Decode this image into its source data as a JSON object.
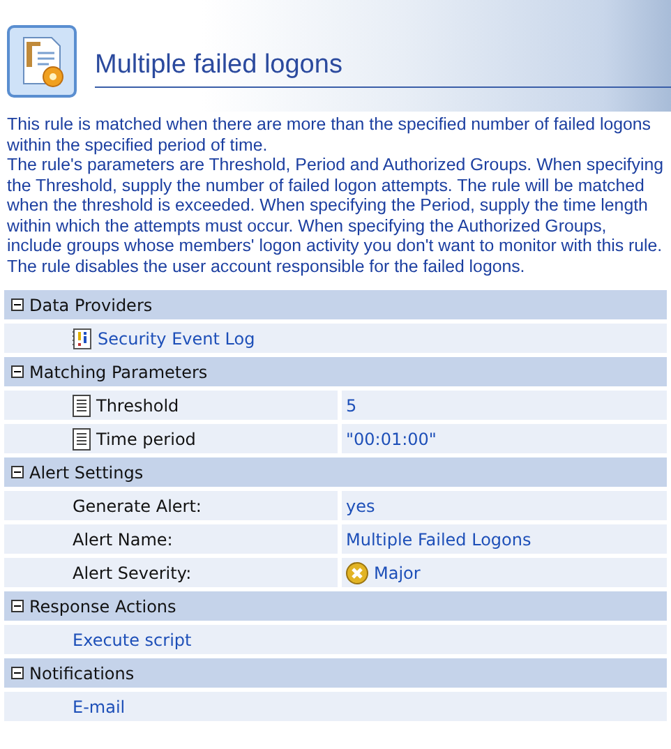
{
  "title": "Multiple failed logons",
  "description": [
    "This rule is matched when there are more than the specified number of failed logons within the specified period of time.",
    "The rule's parameters are Threshold, Period and Authorized Groups. When specifying the Threshold, supply the number of failed logon attempts. The rule will be matched when the threshold is exceeded. When specifying the Period, supply the time length within which the attempts must occur. When specifying the Authorized Groups, include groups whose members' logon activity you don't want to monitor with this rule.",
    "The rule disables the user account responsible for the failed logons."
  ],
  "sections": [
    {
      "title": "Data Providers",
      "expanded": true,
      "rows": [
        {
          "kind": "provider",
          "label": "Security Event Log"
        }
      ]
    },
    {
      "title": "Matching Parameters",
      "expanded": true,
      "rows": [
        {
          "kind": "param",
          "label": "Threshold",
          "value": "5"
        },
        {
          "kind": "param",
          "label": "Time period",
          "value": "\"00:01:00\""
        }
      ]
    },
    {
      "title": "Alert Settings",
      "expanded": true,
      "rows": [
        {
          "kind": "setting",
          "label": "Generate Alert:",
          "value": "yes"
        },
        {
          "kind": "setting",
          "label": "Alert Name:",
          "value": "Multiple Failed Logons"
        },
        {
          "kind": "severity",
          "label": "Alert Severity:",
          "value": "Major"
        }
      ]
    },
    {
      "title": "Response Actions",
      "expanded": true,
      "rows": [
        {
          "kind": "action",
          "label": "Execute script"
        }
      ]
    },
    {
      "title": "Notifications",
      "expanded": true,
      "rows": [
        {
          "kind": "action",
          "label": "E-mail"
        }
      ]
    }
  ]
}
